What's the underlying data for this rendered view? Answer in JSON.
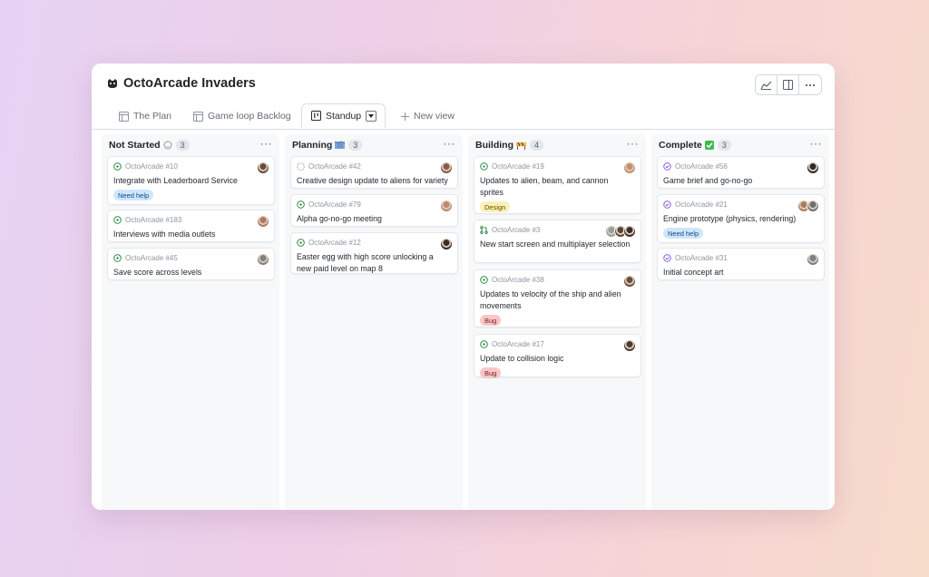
{
  "window": {
    "title": "OctoArcade Invaders"
  },
  "toolbar": {
    "items": [
      "insights-icon",
      "side-panel-icon",
      "more-icon"
    ]
  },
  "tabs": [
    {
      "label": "The Plan",
      "icon": "table-icon",
      "active": false
    },
    {
      "label": "Game loop Backlog",
      "icon": "table-icon",
      "active": false
    },
    {
      "label": "Standup",
      "icon": "board-icon",
      "active": true
    },
    {
      "label": "New view",
      "icon": "plus-icon",
      "active": false
    }
  ],
  "columns": [
    {
      "title": "Not Started",
      "emoji": "white-circle",
      "count": "3",
      "cards": [
        {
          "id": "OctoArcade #10",
          "title": "Integrate with Leaderboard Service",
          "status": "open",
          "label": "Need help",
          "label_kind": "help",
          "avatars": [
            "#6b4a3a"
          ]
        },
        {
          "id": "OctoArcade #183",
          "title": "Interviews with media outlets",
          "status": "open",
          "avatars": [
            "#b07a5b"
          ]
        },
        {
          "id": "OctoArcade #45",
          "title": "Save score across levels",
          "status": "open",
          "avatars": [
            "#7d8082"
          ]
        }
      ]
    },
    {
      "title": "Planning",
      "emoji": "map-icon",
      "count": "3",
      "cards": [
        {
          "id": "OctoArcade #42",
          "title": "Creative design update to aliens for variety",
          "status": "draft",
          "avatars": [
            "#8a5a4a"
          ]
        },
        {
          "id": "OctoArcade #79",
          "title": "Alpha go-no-go meeting",
          "status": "open",
          "avatars": [
            "#c08a6c"
          ]
        },
        {
          "id": "OctoArcade #12",
          "title": "Easter egg with high score unlocking a new paid level on map 8",
          "status": "open",
          "avatars": [
            "#3a2c2a"
          ]
        }
      ]
    },
    {
      "title": "Building",
      "emoji": "construction-icon",
      "count": "4",
      "cards": [
        {
          "id": "OctoArcade #19",
          "title": "Updates to alien, beam, and cannon sprites",
          "status": "open",
          "label": "Design",
          "label_kind": "design",
          "avatars": [
            "#c2906c"
          ]
        },
        {
          "id": "OctoArcade #3",
          "title": "New start screen and multiplayer selection",
          "status": "pr",
          "avatars": [
            "#9a9ea2",
            "#5a4638",
            "#3b2f2a"
          ]
        },
        {
          "id": "OctoArcade #38",
          "title": "Updates to velocity of the ship and alien movements",
          "status": "open",
          "label": "Bug",
          "label_kind": "bug",
          "avatars": [
            "#6a4a3c"
          ]
        },
        {
          "id": "OctoArcade #17",
          "title": "Update to collision logic",
          "status": "open",
          "label": "Bug",
          "label_kind": "bug",
          "avatars": [
            "#4a3a34"
          ]
        }
      ]
    },
    {
      "title": "Complete",
      "emoji": "check-icon",
      "count": "3",
      "cards": [
        {
          "id": "OctoArcade #56",
          "title": "Game brief and go-no-go",
          "status": "closed",
          "avatars": [
            "#2e2a28"
          ]
        },
        {
          "id": "OctoArcade #21",
          "title": "Engine prototype (physics, rendering)",
          "status": "closed",
          "label": "Need help",
          "label_kind": "help",
          "avatars": [
            "#b07a5b",
            "#6d7072"
          ]
        },
        {
          "id": "OctoArcade #31",
          "title": "Initial concept art",
          "status": "closed",
          "avatars": [
            "#7d8082"
          ]
        }
      ]
    }
  ]
}
